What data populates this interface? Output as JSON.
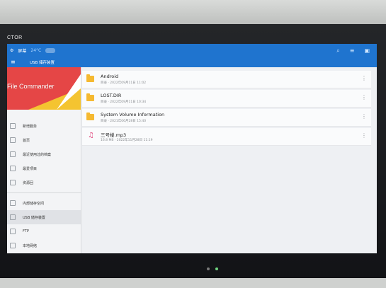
{
  "device": {
    "brand": "CTOR"
  },
  "status_bar": {
    "location": "屏幕",
    "weather": "24°C"
  },
  "app_bar": {
    "title": "USB 储存装置"
  },
  "banner": {
    "app_name": "File Commander"
  },
  "sidebar": {
    "items": [
      {
        "label": "新增服务",
        "icon": "home-icon"
      },
      {
        "label": "首页",
        "icon": "home-icon"
      },
      {
        "label": "最近使用过的档案",
        "icon": "clock-icon"
      },
      {
        "label": "最爱项目",
        "icon": "star-icon"
      },
      {
        "label": "资源回",
        "icon": "trash-icon"
      },
      {
        "label": "内部储存空间",
        "icon": "storage-icon"
      },
      {
        "label": "USB 储存装置",
        "icon": "usb-icon",
        "active": true
      },
      {
        "label": "FTP",
        "icon": "ftp-icon"
      },
      {
        "label": "本地网络",
        "icon": "network-icon"
      }
    ]
  },
  "files": [
    {
      "name": "Android",
      "meta": "目录 · 2022年09月11日 11:02",
      "type": "folder"
    },
    {
      "name": "LOST.DIR",
      "meta": "目录 · 2022年09月11日 10:34",
      "type": "folder"
    },
    {
      "name": "System Volume Information",
      "meta": "目录 · 2021年06月28日 15:40",
      "type": "folder"
    },
    {
      "name": "三号楼.mp3",
      "meta": "16.8 MB · 2022年11月28日 11:19",
      "type": "audio"
    }
  ],
  "colors": {
    "primary": "#1f74cf",
    "banner_red": "#e54646",
    "banner_yellow": "#f4c430",
    "folder": "#f5b931"
  }
}
